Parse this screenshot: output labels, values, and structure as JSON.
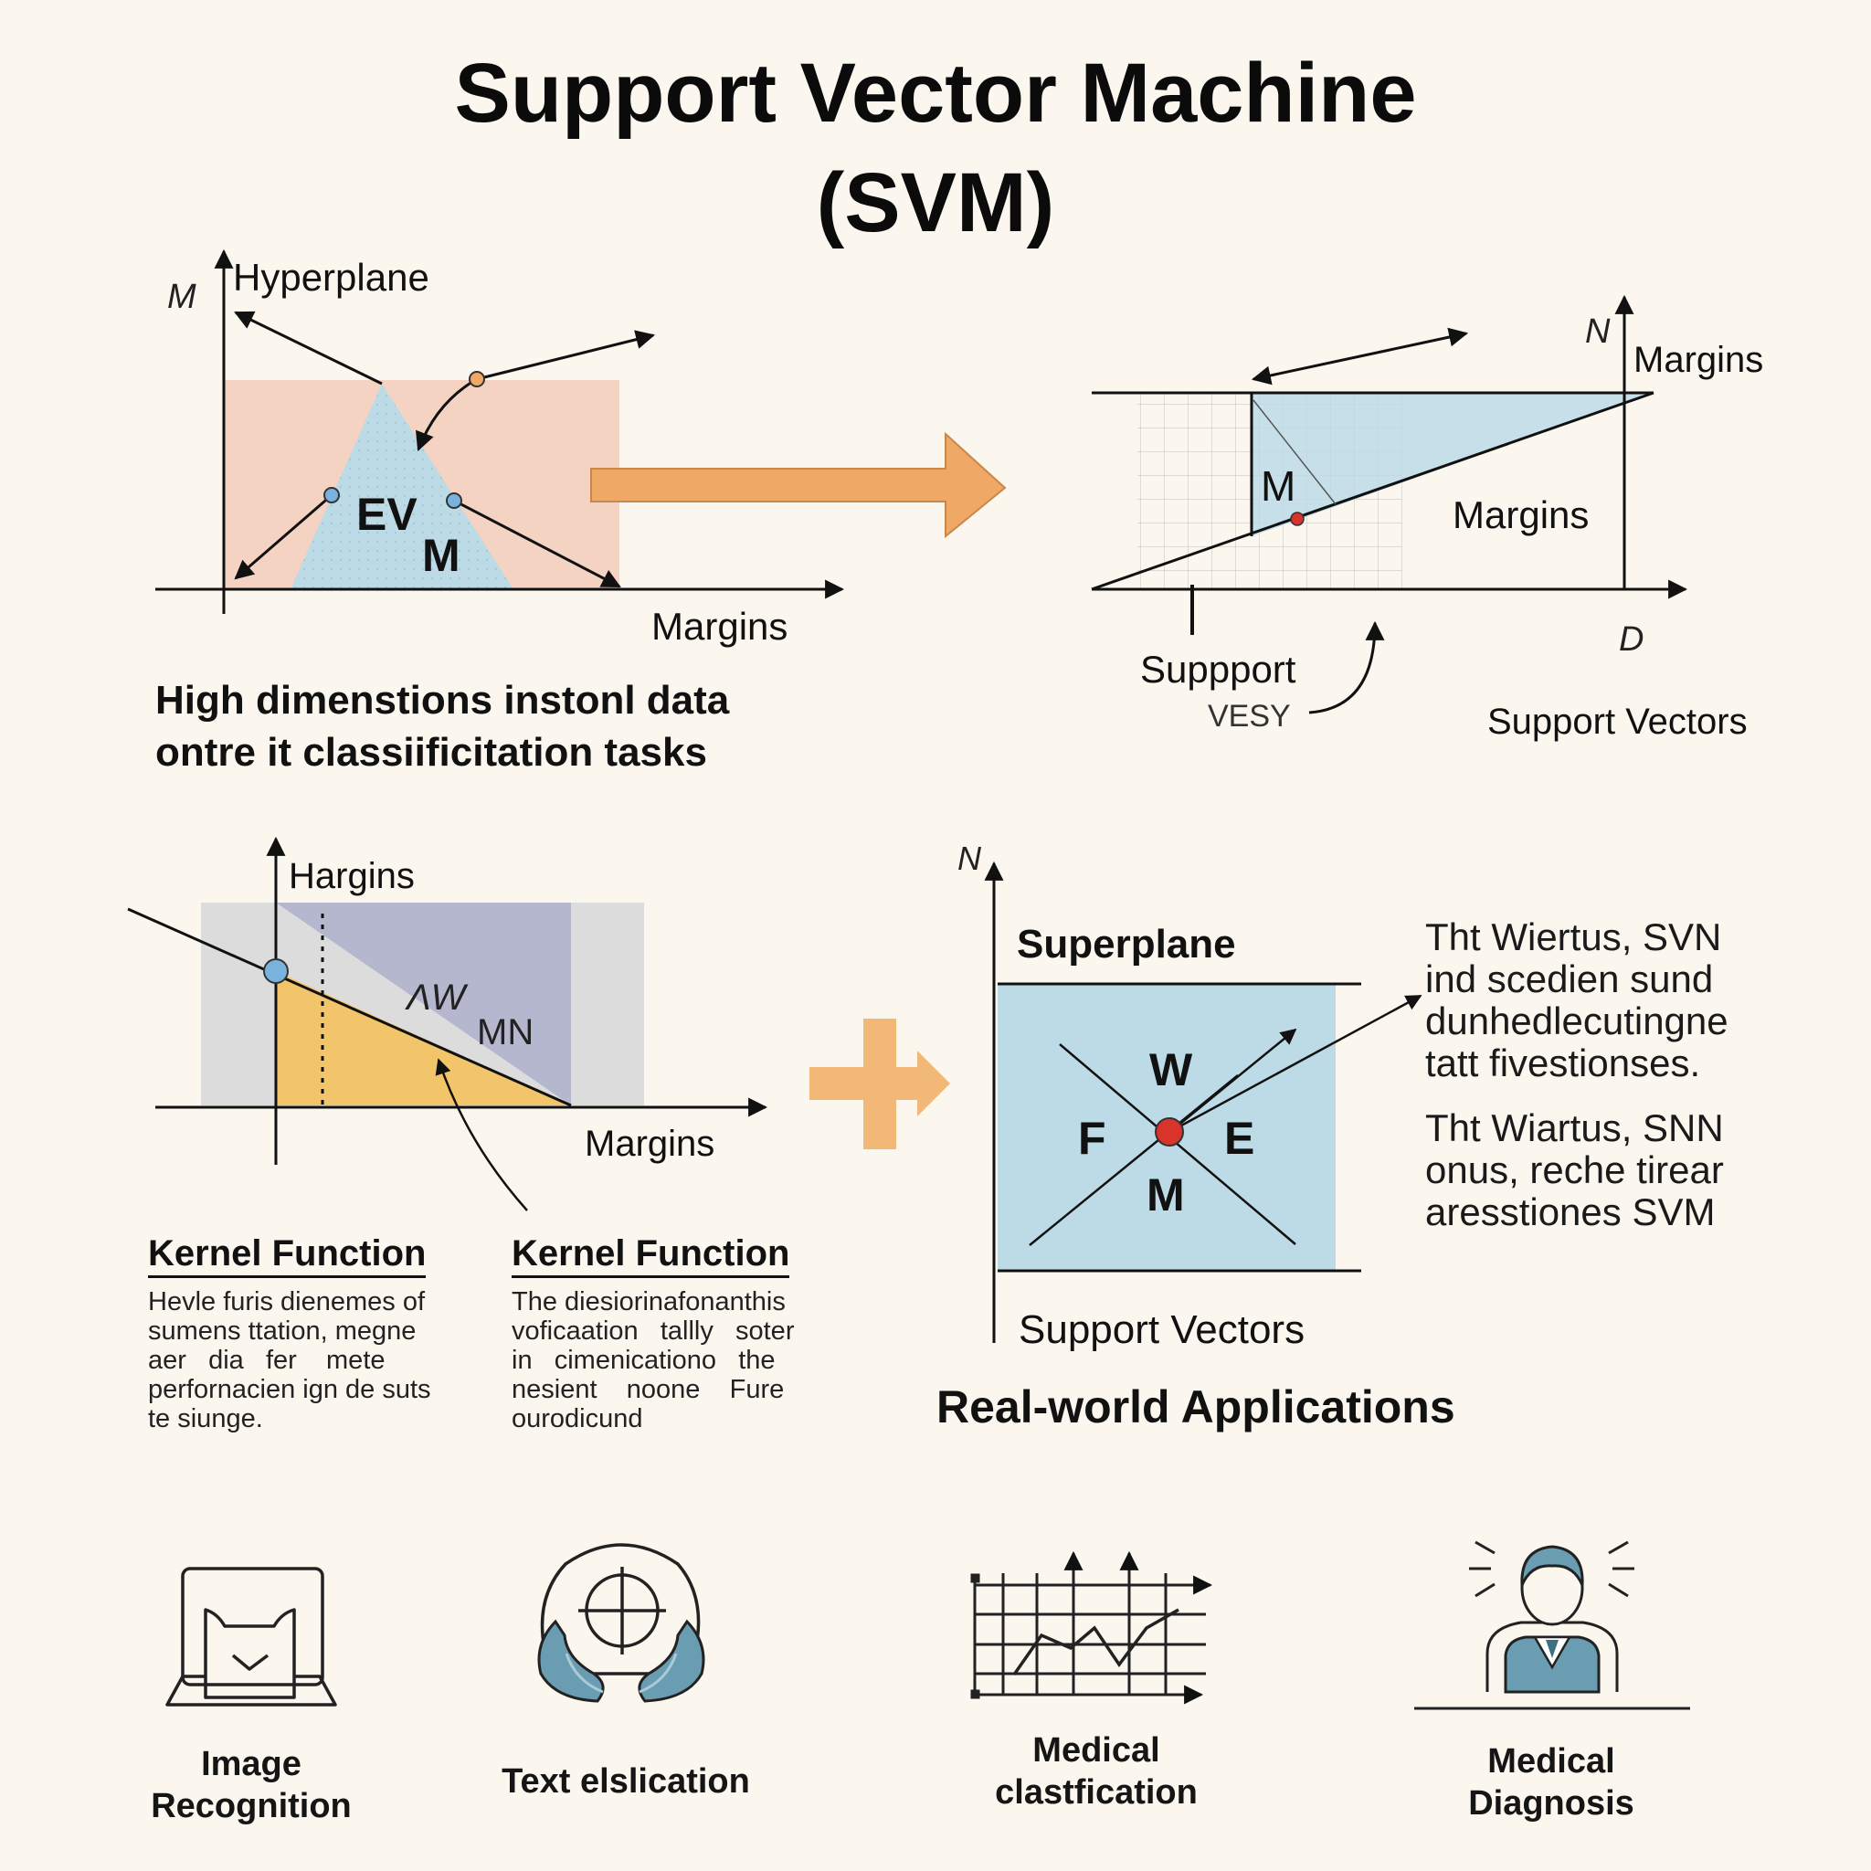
{
  "title": {
    "line1": "Support Vector Machine",
    "line2": "(SVM)"
  },
  "panel1": {
    "axis_label": "M",
    "hyperplane_label": "Hyperplane",
    "shape_label_top": "EV",
    "shape_label_bottom": "M",
    "x_label": "Margins",
    "caption_line1": "High dimenstions instonl data",
    "caption_line2": "ontre it classiificitation tasks"
  },
  "panel2": {
    "axis_label": "N",
    "margins_top": "Margins",
    "m_label": "M",
    "margins_mid": "Margins",
    "d_label": "D",
    "support_label": "Suppport",
    "vesy_label": "VESY",
    "support_vectors": "Support Vectors"
  },
  "panel3": {
    "hargins": "Hargins",
    "w_label": "ΛW",
    "mn_label": "MN",
    "margins": "Margins"
  },
  "kernel": [
    {
      "heading": "Kernel Function",
      "lines": [
        "Hevle furis dienemes of",
        "sumens ttation, megne",
        "aer   dia   fer    mete",
        "perfornacien ign de suts",
        "te siunge."
      ]
    },
    {
      "heading": "Kernel Function",
      "lines": [
        "The diesiorinafonanthis",
        "voficaation   tallly   soter",
        "in   cimenicationo   the",
        "nesient    noone    Fure",
        "ourodicund"
      ]
    }
  ],
  "panel4": {
    "axis_label": "N",
    "superplane": "Superplane",
    "w": "W",
    "f": "F",
    "e": "E",
    "m": "M",
    "support_vectors": "Support Vectors",
    "desc1": [
      "Tht Wiertus, SVN",
      "ind scedien sund",
      "dunhedlecutingne",
      "tatt fivestionses."
    ],
    "desc2": [
      "Tht Wiartus, SNN",
      "onus, reche tirear",
      "aresstiones SVM"
    ]
  },
  "applications": {
    "heading": "Real-world Applications",
    "items": [
      {
        "label_line1": "Image",
        "label_line2": "Recognition",
        "icon": "image-recognition-icon"
      },
      {
        "label_line1": "Text elslication",
        "label_line2": "",
        "icon": "head-target-icon"
      },
      {
        "label_line1": "Medical",
        "label_line2": "clastfication",
        "icon": "chart-icon"
      },
      {
        "label_line1": "Medical",
        "label_line2": "Diagnosis",
        "icon": "doctor-icon"
      }
    ]
  },
  "colors": {
    "background": "#fbf6ee",
    "salmon": "#f4d3c2",
    "light_blue": "#bcdbe6",
    "orange_arrow": "#efa865",
    "lavender": "#b5b7cf",
    "yellow": "#f2c56a",
    "red_point": "#d9342b",
    "blue_point": "#79b2dc",
    "icon_teal": "#6a9db2"
  }
}
